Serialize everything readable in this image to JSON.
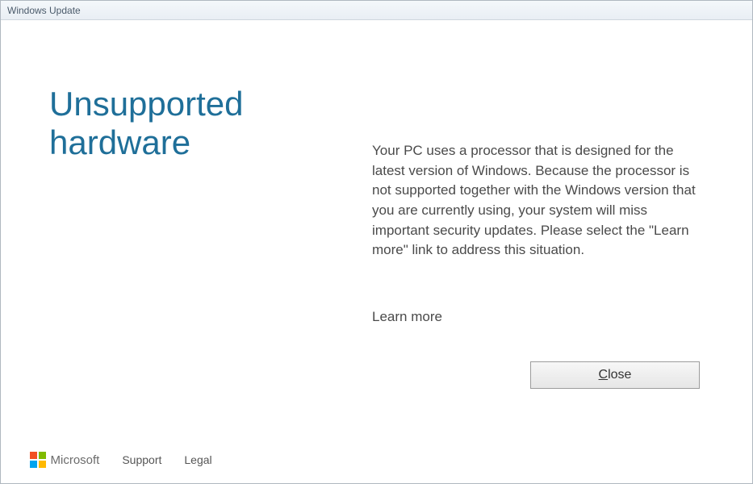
{
  "window": {
    "title": "Windows Update"
  },
  "main": {
    "heading": "Unsupported hardware",
    "body": "Your PC uses a processor that is designed for the latest version of Windows. Because the processor is not supported together with the Windows version that you are currently using, your system will miss important security updates. Please select the \"Learn more\" link to address this situation.",
    "learn_more": "Learn more",
    "close_prefix": "C",
    "close_rest": "lose"
  },
  "footer": {
    "brand": "Microsoft",
    "support": "Support",
    "legal": "Legal"
  }
}
